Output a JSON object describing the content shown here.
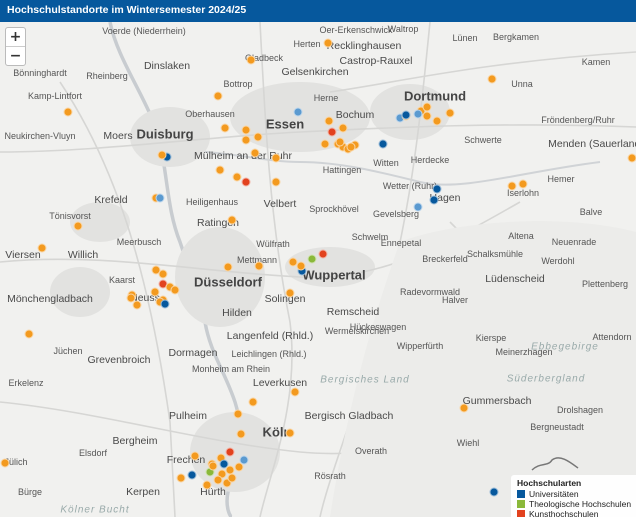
{
  "title": "Hochschulstandorte im Wintersemester 2024/25",
  "zoom": {
    "in_label": "+",
    "out_label": "−"
  },
  "legend": {
    "title": "Hochschularten",
    "items": [
      {
        "label": "Universitäten",
        "color": "#06589d"
      },
      {
        "label": "Theologische Hochschulen",
        "color": "#8ab83a"
      },
      {
        "label": "Kunsthochschulen",
        "color": "#e2421e"
      }
    ]
  },
  "colors": {
    "universitaet": "#06589d",
    "theologisch": "#8ab83a",
    "kunst": "#e2421e",
    "fachhochschule": "#f39a1f",
    "universitaet_light": "#5b9ad0"
  },
  "cities": {
    "duisburg": "Duisburg",
    "essen": "Essen",
    "dortmund": "Dortmund",
    "duesseldorf": "Düsseldorf",
    "wuppertal": "Wuppertal",
    "koeln": "Köln",
    "moenchengladbach": "Mönchengladbach",
    "bochum": "Bochum",
    "gelsenkirchen": "Gelsenkirchen",
    "oberhausen": "Oberhausen",
    "muelheim": "Mülheim an der Ruhr",
    "bottrop": "Bottrop",
    "gladbeck": "Gladbeck",
    "herne": "Herne",
    "hattingen": "Hattingen",
    "witten": "Witten",
    "hagen": "Hagen",
    "herdecke": "Herdecke",
    "unna": "Unna",
    "schwerte": "Schwerte",
    "iserlohn": "Iserlohn",
    "menden": "Menden (Sauerland)",
    "froendenberg": "Fröndenberg/Ruhr",
    "kamen": "Kamen",
    "luenen": "Lünen",
    "bergkamen": "Bergkamen",
    "waltrop": "Waltrop",
    "castrop": "Castrop-Rauxel",
    "recklinghausen": "Recklinghausen",
    "herten": "Herten",
    "oer": "Oer-Erkenschwick",
    "dinslaken": "Dinslaken",
    "voerde": "Voerde (Niederrhein)",
    "rheinberg": "Rheinberg",
    "kamplintfort": "Kamp-Lintfort",
    "moers": "Moers",
    "neukirchen": "Neukirchen-Vluyn",
    "krefeld": "Krefeld",
    "toenisvorst": "Tönisvorst",
    "willich": "Willich",
    "viersen": "Viersen",
    "meerbusch": "Meerbusch",
    "kaarst": "Kaarst",
    "neuss": "Neuss",
    "ratingen": "Ratingen",
    "heiligenhaus": "Heiligenhaus",
    "velbert": "Velbert",
    "sprockhoevel": "Sprockhövel",
    "wetter": "Wetter (Ruhr)",
    "gevelsberg": "Gevelsberg",
    "ennepetal": "Ennepetal",
    "schwelm": "Schwelm",
    "mettmann": "Mettmann",
    "wuelfrath": "Wülfrath",
    "hilden": "Hilden",
    "solingen": "Solingen",
    "remscheid": "Remscheid",
    "radevormwald": "Radevormwald",
    "langenfeld": "Langenfeld (Rhld.)",
    "leichlingen": "Leichlingen (Rhld.)",
    "dormagen": "Dormagen",
    "grevenbroich": "Grevenbroich",
    "monheim": "Monheim am Rhein",
    "leverkusen": "Leverkusen",
    "bergischgladbach": "Bergisch Gladbach",
    "bergheim": "Bergheim",
    "pulheim": "Pulheim",
    "frechen": "Frechen",
    "huerth": "Hürth",
    "kerpen": "Kerpen",
    "overath": "Overath",
    "roesrath": "Rösrath",
    "wermelskirchen": "Wermelskirchen",
    "wipperfuerth": "Wipperfürth",
    "huekeswagen": "Hückeswagen",
    "gummersbach": "Gummersbach",
    "wiehl": "Wiehl",
    "kierspe": "Kierspe",
    "meinerzhagen": "Meinerzhagen",
    "halver": "Halver",
    "breckerfeld": "Breckerfeld",
    "luedenscheid": "Lüdenscheid",
    "schalksmuehle": "Schalksmühle",
    "altena": "Altena",
    "neuenrade": "Neuenrade",
    "werdohl": "Werdohl",
    "plettenberg": "Plettenberg",
    "balve": "Balve",
    "hemer": "Hemer",
    "attendorn": "Attendorn",
    "drolshagen": "Drolshagen",
    "bergneustadt": "Bergneustadt",
    "juechen": "Jüchen",
    "erkelenz": "Erkelenz",
    "elsdorf": "Elsdorf",
    "juelich": "Jülich",
    "kirchhellen": "Bönninghardt",
    "bergisches_land": "Bergisches Land",
    "sauerland": "Süderbergland",
    "ebbegebirge": "Ebbegebirge",
    "buerge": "Bürge",
    "koelnerbucht": "Kölner Bucht"
  },
  "points": [
    {
      "type": "fachhochschule"
    },
    {
      "type": "fachhochschule"
    },
    {
      "type": "fachhochschule"
    },
    {
      "type": "fachhochschule"
    },
    {
      "type": "universitaet_light"
    },
    {
      "type": "fachhochschule"
    },
    {
      "type": "fachhochschule"
    },
    {
      "type": "fachhochschule"
    },
    {
      "type": "fachhochschule"
    },
    {
      "type": "fachhochschule"
    },
    {
      "type": "fachhochschule"
    },
    {
      "type": "universitaet"
    },
    {
      "type": "fachhochschule"
    },
    {
      "type": "universitaet_light"
    },
    {
      "type": "fachhochschule"
    },
    {
      "type": "fachhochschule"
    },
    {
      "type": "kunst"
    },
    {
      "type": "fachhochschule"
    },
    {
      "type": "fachhochschule"
    },
    {
      "type": "fachhochschule"
    },
    {
      "type": "fachhochschule"
    },
    {
      "type": "fachhochschule"
    },
    {
      "type": "universitaet"
    },
    {
      "type": "fachhochschule"
    },
    {
      "type": "fachhochschule"
    },
    {
      "type": "fachhochschule"
    },
    {
      "type": "fachhochschule"
    },
    {
      "type": "universitaet"
    },
    {
      "type": "universitaet_light"
    },
    {
      "type": "fachhochschule"
    },
    {
      "type": "fachhochschule"
    },
    {
      "type": "fachhochschule"
    },
    {
      "type": "fachhochschule"
    },
    {
      "type": "fachhochschule"
    },
    {
      "type": "universitaet"
    },
    {
      "type": "fachhochschule"
    },
    {
      "type": "fachhochschule"
    },
    {
      "type": "universitaet"
    },
    {
      "type": "universitaet_light"
    },
    {
      "type": "fachhochschule"
    },
    {
      "type": "fachhochschule"
    },
    {
      "type": "fachhochschule"
    },
    {
      "type": "fachhochschule"
    },
    {
      "type": "universitaet_light"
    },
    {
      "type": "fachhochschule"
    },
    {
      "type": "fachhochschule"
    },
    {
      "type": "fachhochschule"
    },
    {
      "type": "fachhochschule"
    },
    {
      "type": "fachhochschule"
    },
    {
      "type": "kunst"
    },
    {
      "type": "fachhochschule"
    },
    {
      "type": "fachhochschule"
    },
    {
      "type": "fachhochschule"
    },
    {
      "type": "fachhochschule"
    },
    {
      "type": "kunst"
    },
    {
      "type": "fachhochschule"
    },
    {
      "type": "fachhochschule"
    },
    {
      "type": "fachhochschule"
    },
    {
      "type": "fachhochschule"
    },
    {
      "type": "fachhochschule"
    },
    {
      "type": "universitaet"
    },
    {
      "type": "fachhochschule"
    },
    {
      "type": "fachhochschule"
    },
    {
      "type": "fachhochschule"
    },
    {
      "type": "theologisch"
    },
    {
      "type": "kunst"
    },
    {
      "type": "universitaet"
    },
    {
      "type": "fachhochschule"
    },
    {
      "type": "fachhochschule"
    },
    {
      "type": "fachhochschule"
    },
    {
      "type": "fachhochschule"
    },
    {
      "type": "fachhochschule"
    },
    {
      "type": "fachhochschule"
    },
    {
      "type": "fachhochschule"
    },
    {
      "type": "kunst"
    },
    {
      "type": "fachhochschule"
    },
    {
      "type": "fachhochschule"
    },
    {
      "type": "fachhochschule"
    },
    {
      "type": "universitaet"
    },
    {
      "type": "fachhochschule"
    },
    {
      "type": "fachhochschule"
    },
    {
      "type": "theologisch"
    },
    {
      "type": "fachhochschule"
    },
    {
      "type": "fachhochschule"
    },
    {
      "type": "fachhochschule"
    },
    {
      "type": "universitaet_light"
    },
    {
      "type": "fachhochschule"
    },
    {
      "type": "fachhochschule"
    },
    {
      "type": "fachhochschule"
    },
    {
      "type": "universitaet"
    },
    {
      "type": "fachhochschule"
    },
    {
      "type": "fachhochschule"
    },
    {
      "type": "fachhochschule"
    },
    {
      "type": "universitaet"
    },
    {
      "type": "fachhochschule"
    }
  ]
}
